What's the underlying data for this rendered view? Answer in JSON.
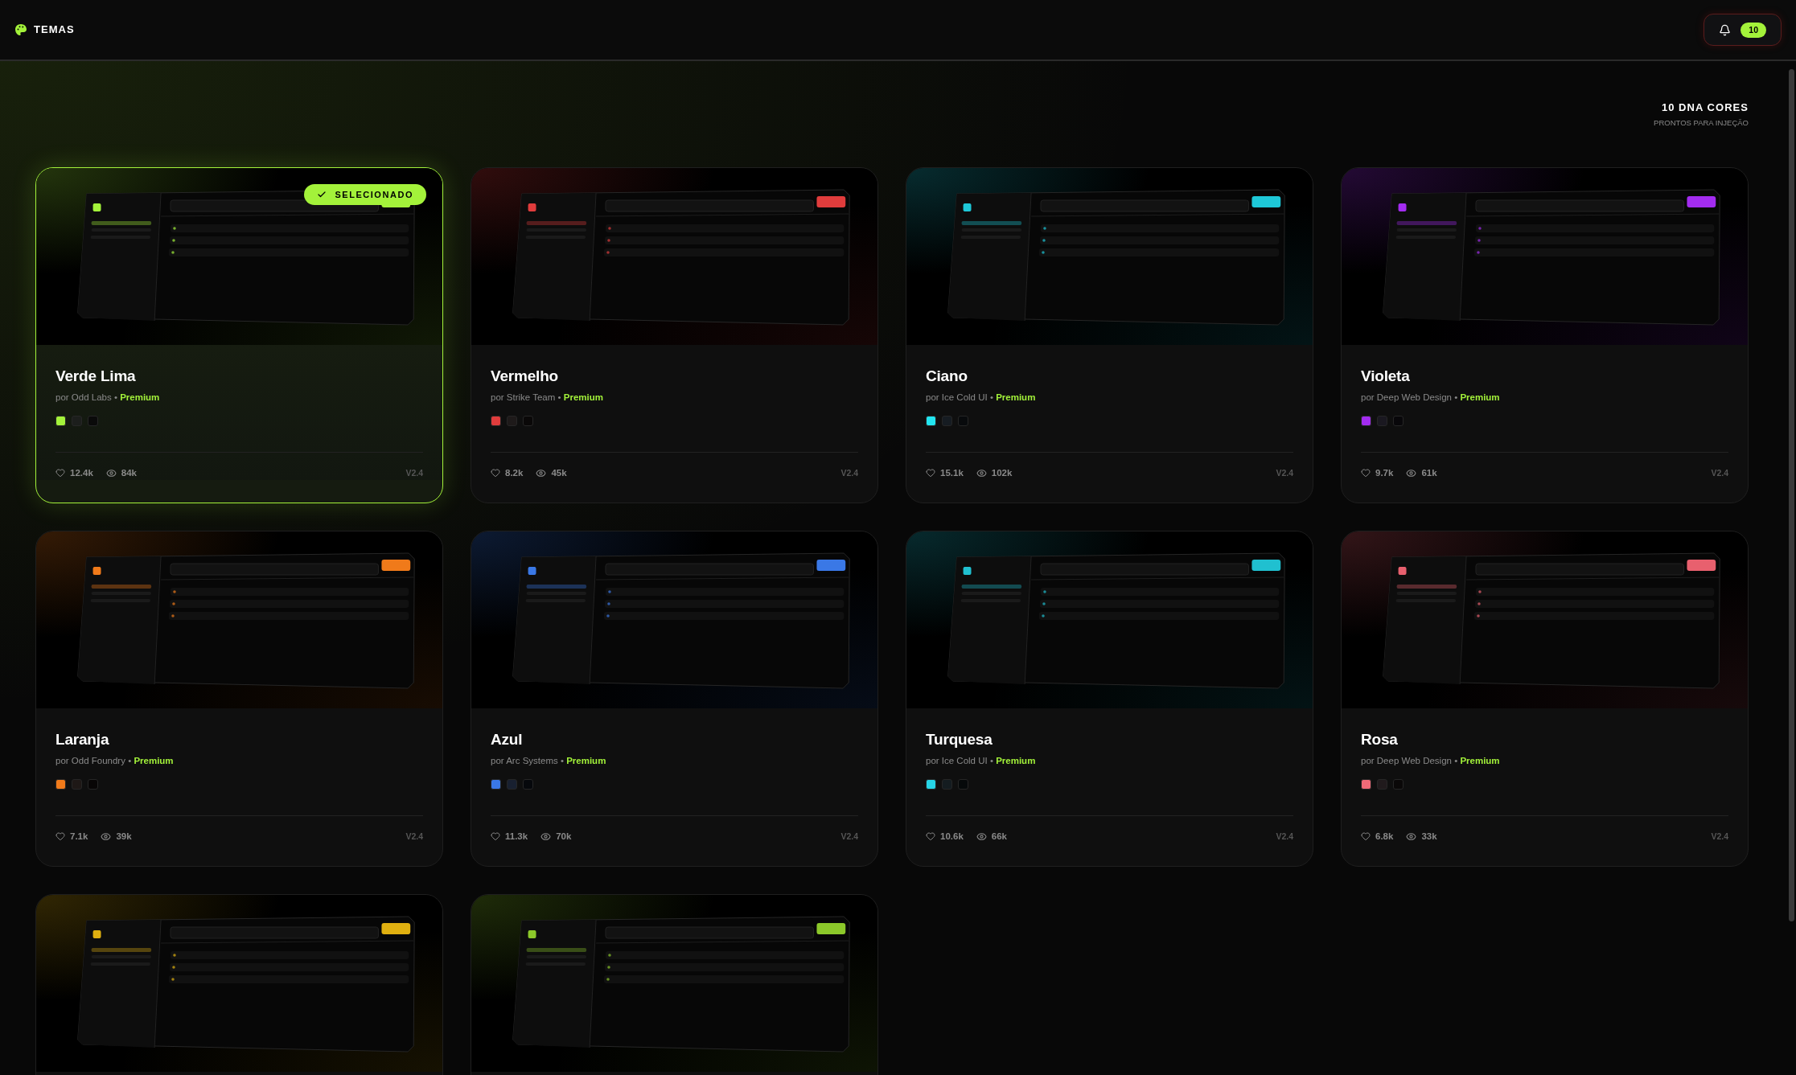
{
  "header": {
    "title": "TEMAS",
    "notifications": {
      "count": "10"
    }
  },
  "summary": {
    "title": "10 DNA CORES",
    "subtitle": "PRONTOS PARA INJEÇÃO"
  },
  "selected_badge": "SELECIONADO",
  "cards": [
    {
      "name": "Verde Lima",
      "author": "por Odd Labs",
      "separator": "•",
      "tier": "Premium",
      "selected": true,
      "color": "#a3f23a",
      "swatches": [
        {
          "color": "#a3f23a"
        },
        {
          "color": "#1c1e1c"
        },
        {
          "color": "#0a0a0a"
        }
      ],
      "likes": "12.4k",
      "views": "84k",
      "version": "V2.4"
    },
    {
      "name": "Vermelho",
      "author": "por Strike Team",
      "separator": "•",
      "tier": "Premium",
      "selected": false,
      "color": "#e03c3c",
      "swatches": [
        {
          "color": "#e03c3c"
        },
        {
          "color": "#1e1a1a"
        },
        {
          "color": "#0a0808"
        }
      ],
      "likes": "8.2k",
      "views": "45k",
      "version": "V2.4"
    },
    {
      "name": "Ciano",
      "author": "por Ice Cold UI",
      "separator": "•",
      "tier": "Premium",
      "selected": false,
      "color": "#1ec8d8",
      "swatches": [
        {
          "color": "#22e5f0"
        },
        {
          "color": "#161c22"
        },
        {
          "color": "#080a0c"
        }
      ],
      "likes": "15.1k",
      "views": "102k",
      "version": "V2.4"
    },
    {
      "name": "Violeta",
      "author": "por Deep Web Design",
      "separator": "•",
      "tier": "Premium",
      "selected": false,
      "color": "#a32cf0",
      "swatches": [
        {
          "color": "#a32cf0"
        },
        {
          "color": "#1a1820"
        },
        {
          "color": "#08070a"
        }
      ],
      "likes": "9.7k",
      "views": "61k",
      "version": "V2.4"
    },
    {
      "name": "Laranja",
      "author": "por Odd Foundry",
      "separator": "•",
      "tier": "Premium",
      "selected": false,
      "color": "#f07a1a",
      "swatches": [
        {
          "color": "#f07a1a"
        },
        {
          "color": "#1e1816"
        },
        {
          "color": "#080606"
        }
      ],
      "likes": "7.1k",
      "views": "39k",
      "version": "V2.4"
    },
    {
      "name": "Azul",
      "author": "por Arc Systems",
      "separator": "•",
      "tier": "Premium",
      "selected": false,
      "color": "#3a78e6",
      "swatches": [
        {
          "color": "#3a78e6"
        },
        {
          "color": "#182030"
        },
        {
          "color": "#06080c"
        }
      ],
      "likes": "11.3k",
      "views": "70k",
      "version": "V2.4"
    },
    {
      "name": "Turquesa",
      "author": "por Ice Cold UI",
      "separator": "•",
      "tier": "Premium",
      "selected": false,
      "color": "#20c0d0",
      "swatches": [
        {
          "color": "#26d4e6"
        },
        {
          "color": "#141c20"
        },
        {
          "color": "#06090a"
        }
      ],
      "likes": "10.6k",
      "views": "66k",
      "version": "V2.4"
    },
    {
      "name": "Rosa",
      "author": "por Deep Web Design",
      "separator": "•",
      "tier": "Premium",
      "selected": false,
      "color": "#e8606e",
      "swatches": [
        {
          "color": "#f06a78"
        },
        {
          "color": "#201a1c"
        },
        {
          "color": "#0a0808"
        }
      ],
      "likes": "6.8k",
      "views": "33k",
      "version": "V2.4"
    },
    {
      "selected": false,
      "color": "#e0b010"
    },
    {
      "selected": false,
      "color": "#8cc82a"
    }
  ]
}
